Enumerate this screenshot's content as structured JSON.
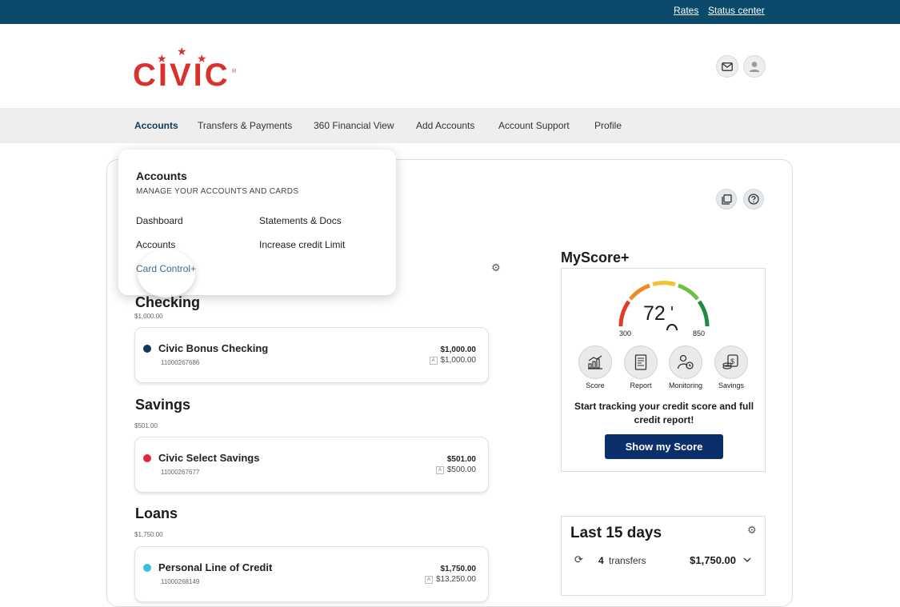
{
  "topbar": {
    "rates": "Rates",
    "status_center": "Status center"
  },
  "logo": {
    "text": "CIVIC",
    "reg": "®"
  },
  "nav": [
    "Accounts",
    "Transfers & Payments",
    "360 Financial View",
    "Add Accounts",
    "Account Support",
    "Profile"
  ],
  "dropdown": {
    "title": "Accounts",
    "subtitle": "MANAGE YOUR ACCOUNTS AND CARDS",
    "dashboard": "Dashboard",
    "statements": "Statements & Docs",
    "accounts": "Accounts",
    "increase_limit": "Increase credit Limit",
    "card_control": "Card Control+"
  },
  "sections": {
    "checking": {
      "title": "Checking",
      "total": "$1,000.00",
      "account": {
        "name": "Civic Bonus Checking",
        "number": "11000267686",
        "balance": "$1,000.00",
        "available": "$1,000.00"
      }
    },
    "savings": {
      "title": "Savings",
      "total": "$501.00",
      "account": {
        "name": "Civic Select Savings",
        "number": "11000267677",
        "balance": "$501.00",
        "available": "$500.00"
      }
    },
    "loans": {
      "title": "Loans",
      "total": "$1,750.00",
      "account": {
        "name": "Personal Line of Credit",
        "number": "11000268149",
        "balance": "$1,750.00",
        "available": "$13,250.00"
      }
    }
  },
  "avail_tag": "A",
  "myscore": {
    "title": "MyScore+",
    "score_partial": "72",
    "min": "300",
    "max": "850",
    "tools": [
      "Score",
      "Report",
      "Monitoring",
      "Savings"
    ],
    "message": "Start tracking your credit score and full credit report!",
    "button": "Show my Score"
  },
  "last15": {
    "title": "Last 15 days",
    "count": "4",
    "label": "transfers",
    "amount": "$1,750.00"
  },
  "colors": {
    "topbar": "#0b4a6b",
    "brand_red": "#d9312b",
    "checking_dot": "#0b3a5b",
    "savings_dot": "#e0283a",
    "loans_dot": "#38c0e0",
    "button": "#0b2f6b"
  }
}
